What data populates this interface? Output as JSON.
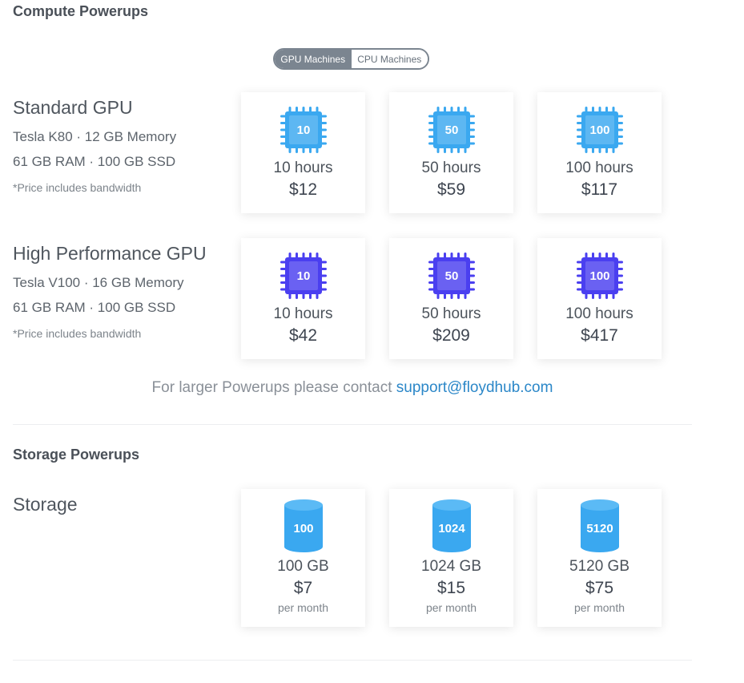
{
  "compute": {
    "title": "Compute Powerups",
    "toggle": {
      "options": [
        "GPU Machines",
        "CPU Machines"
      ],
      "selected": "GPU Machines"
    },
    "tiers": [
      {
        "name": "Standard GPU",
        "spec1": "Tesla K80 · 12 GB Memory",
        "spec2": "61 GB RAM · 100 GB SSD",
        "note": "*Price includes bandwidth",
        "color": "#3aa8f0",
        "cards": [
          {
            "chip": "10",
            "hours": "10 hours",
            "price": "$12"
          },
          {
            "chip": "50",
            "hours": "50 hours",
            "price": "$59"
          },
          {
            "chip": "100",
            "hours": "100 hours",
            "price": "$117"
          }
        ]
      },
      {
        "name": "High Performance GPU",
        "spec1": "Tesla V100 · 16 GB Memory",
        "spec2": "61 GB RAM · 100 GB SSD",
        "note": "*Price includes bandwidth",
        "color": "#4a3ff0",
        "cards": [
          {
            "chip": "10",
            "hours": "10 hours",
            "price": "$42"
          },
          {
            "chip": "50",
            "hours": "50 hours",
            "price": "$209"
          },
          {
            "chip": "100",
            "hours": "100 hours",
            "price": "$417"
          }
        ]
      }
    ],
    "contact_text": "For larger Powerups please contact",
    "contact_email": "support@floydhub.com"
  },
  "storage": {
    "title": "Storage Powerups",
    "name": "Storage",
    "color": "#3aa8f0",
    "cards": [
      {
        "label": "100",
        "size": "100 GB",
        "price": "$7",
        "period": "per month"
      },
      {
        "label": "1024",
        "size": "1024 GB",
        "price": "$15",
        "period": "per month"
      },
      {
        "label": "5120",
        "size": "5120 GB",
        "price": "$75",
        "period": "per month"
      }
    ]
  }
}
